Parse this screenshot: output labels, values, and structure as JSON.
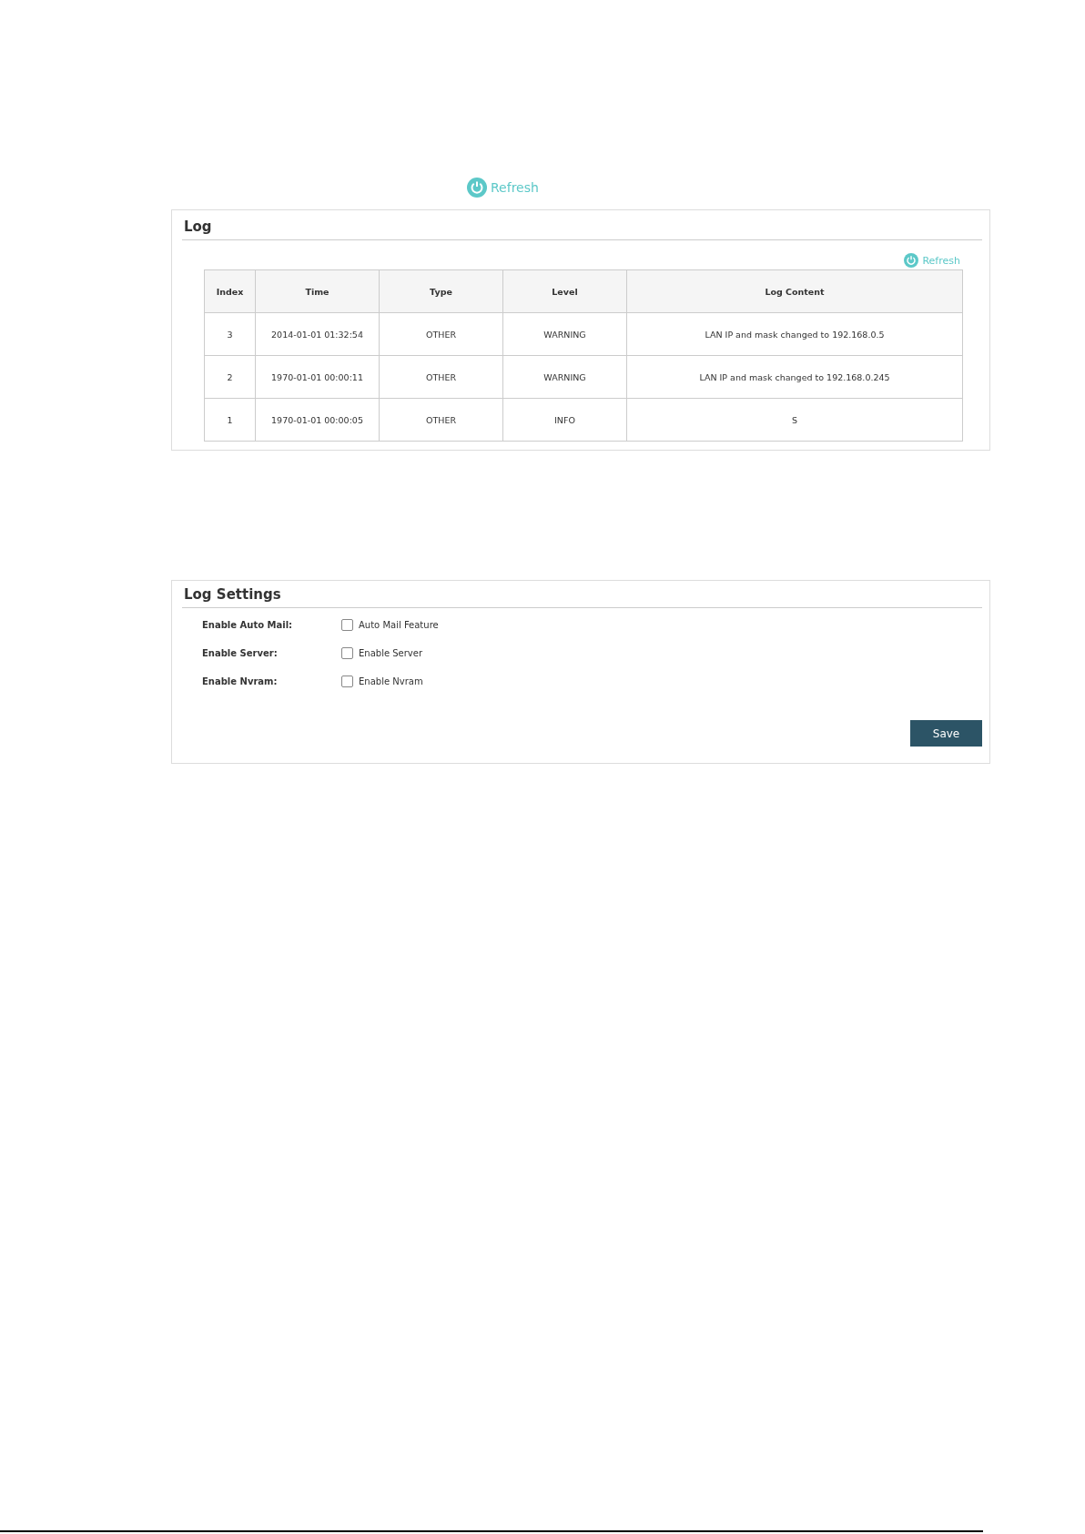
{
  "refresh_top": {
    "label": "Refresh"
  },
  "log": {
    "title": "Log",
    "refresh": {
      "label": "Refresh"
    },
    "columns": [
      "Index",
      "Time",
      "Type",
      "Level",
      "Log Content"
    ],
    "rows": [
      [
        "3",
        "2014-01-01 01:32:54",
        "OTHER",
        "WARNING",
        "LAN IP and mask changed to 192.168.0.5"
      ],
      [
        "2",
        "1970-01-01 00:00:11",
        "OTHER",
        "WARNING",
        "LAN IP and mask changed to 192.168.0.245"
      ],
      [
        "1",
        "1970-01-01 00:00:05",
        "OTHER",
        "INFO",
        "S"
      ]
    ]
  },
  "log_settings": {
    "title": "Log Settings",
    "fields": [
      {
        "label": "Enable Auto Mail:",
        "option": "Auto Mail Feature",
        "checked": false
      },
      {
        "label": "Enable Server:",
        "option": "Enable Server",
        "checked": false
      },
      {
        "label": "Enable Nvram:",
        "option": "Enable Nvram",
        "checked": false
      }
    ],
    "save": "Save"
  }
}
